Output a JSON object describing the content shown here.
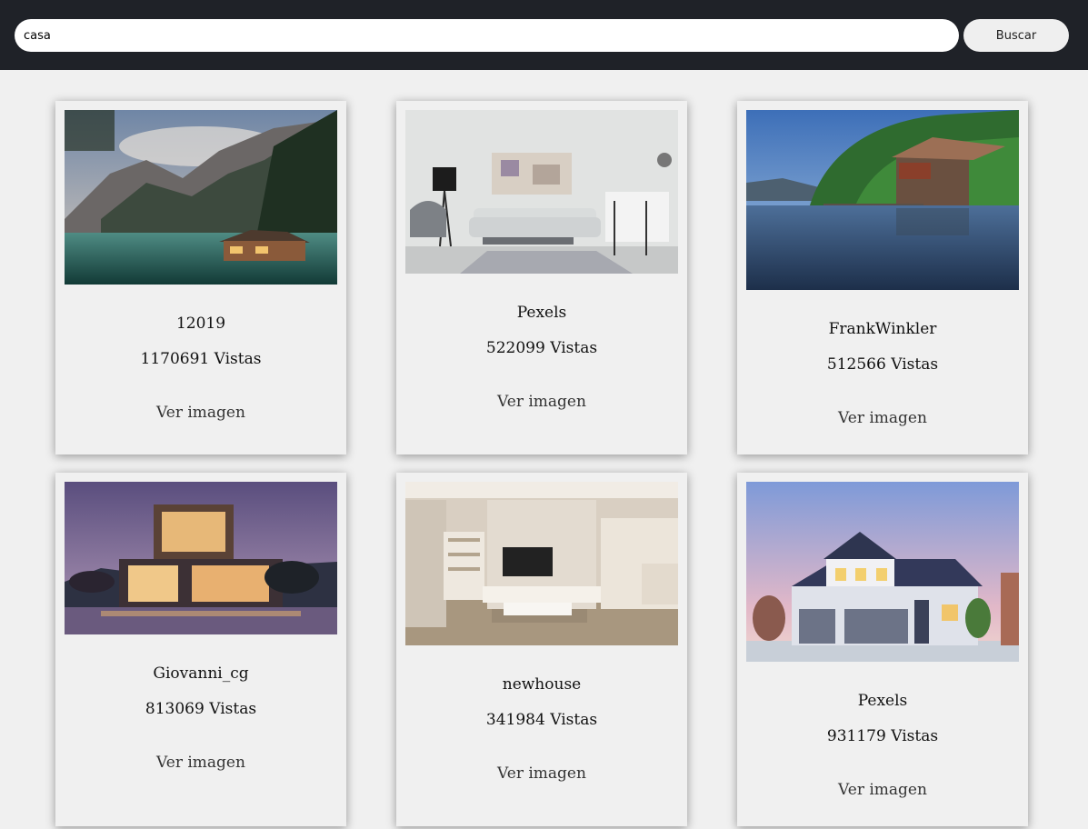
{
  "search": {
    "value": "casa",
    "button_label": "Buscar"
  },
  "results": [
    {
      "author": "12019",
      "views": "1170691 Vistas",
      "link_label": "Ver imagen",
      "image": "mountain-lake-cabin"
    },
    {
      "author": "Pexels",
      "views": "522099 Vistas",
      "link_label": "Ver imagen",
      "image": "living-room-sofa"
    },
    {
      "author": "FrankWinkler",
      "views": "512566 Vistas",
      "link_label": "Ver imagen",
      "image": "lakeside-boathouse"
    },
    {
      "author": "Giovanni_cg",
      "views": "813069 Vistas",
      "link_label": "Ver imagen",
      "image": "modern-house-dusk"
    },
    {
      "author": "newhouse",
      "views": "341984 Vistas",
      "link_label": "Ver imagen",
      "image": "interior-tv-room"
    },
    {
      "author": "Pexels",
      "views": "931179 Vistas",
      "link_label": "Ver imagen",
      "image": "suburban-house-garage"
    }
  ]
}
